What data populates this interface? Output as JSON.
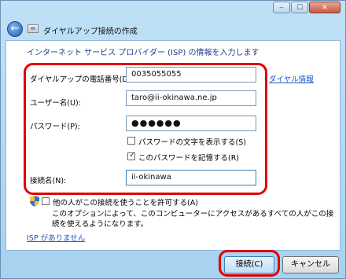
{
  "window": {
    "title": "ダイヤルアップ接続の作成",
    "controls": {
      "minimize": "‒",
      "maximize": "☐",
      "close": "✕"
    },
    "back_icon": "←"
  },
  "main": {
    "heading": "インターネット サービス プロバイダー (ISP) の情報を入力します",
    "phone": {
      "label": "ダイヤルアップの電話番号(D):",
      "value": "0035055055"
    },
    "dialing_rules_link": "ダイヤル情報",
    "username": {
      "label": "ユーザー名(U):",
      "value": "taro@ii-okinawa.ne.jp"
    },
    "password": {
      "label": "パスワード(P):",
      "value": "●●●●●●"
    },
    "show_password": {
      "label": "パスワードの文字を表示する(S)",
      "checked": false
    },
    "remember_password": {
      "label": "このパスワードを記憶する(R)",
      "checked": true
    },
    "connection_name": {
      "label": "接続名(N):",
      "value": "ii-okinawa"
    },
    "allow_others": {
      "label": "他の人がこの接続を使うことを許可する(A)",
      "checked": false
    },
    "allow_desc": "このオプションによって、このコンピューターにアクセスがあるすべての人がこの接続を使えるようになります。",
    "no_isp_link": "ISP がありません"
  },
  "footer": {
    "connect_label": "接続(C)",
    "cancel_label": "キャンセル"
  },
  "colors": {
    "highlight": "#e00000",
    "link": "#1a56c2",
    "heading": "#1e3d8f"
  }
}
